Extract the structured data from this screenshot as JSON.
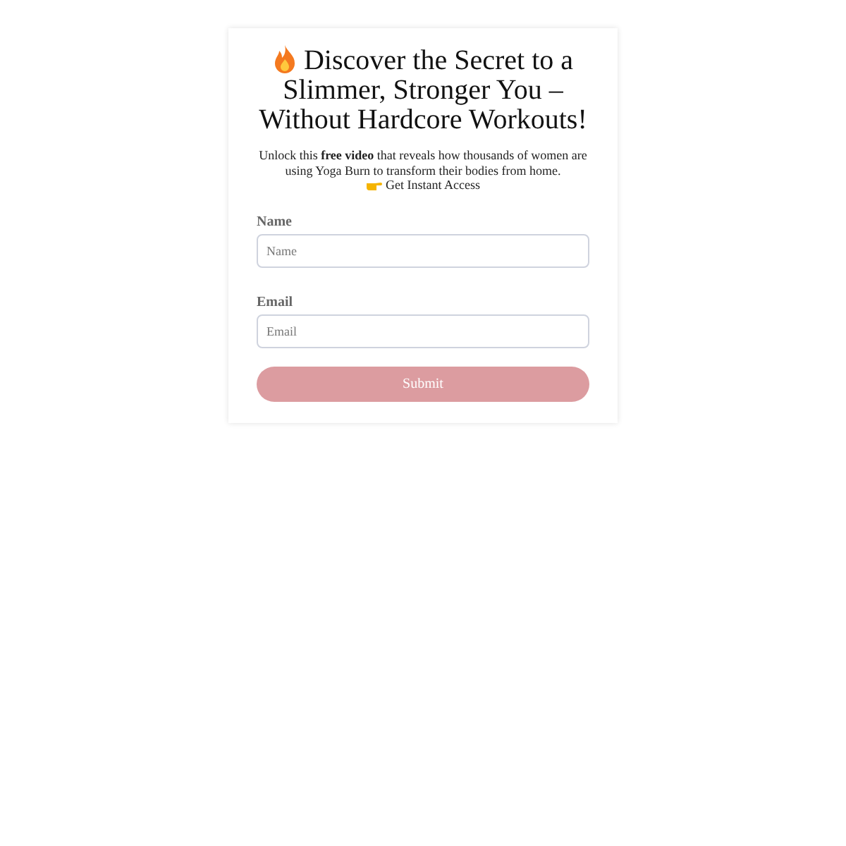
{
  "card": {
    "title": "Discover the Secret to a Slimmer, Stronger You – Without Hardcore Workouts!",
    "description": "Unlock this **free video** that reveals how thousands of women are using Yoga Burn to transform their bodies from home.",
    "cta": "Get Instant Access",
    "fields": [
      {
        "label": "Name",
        "placeholder": "Name"
      },
      {
        "label": "Email",
        "placeholder": "Email"
      }
    ],
    "submit": "Submit"
  }
}
